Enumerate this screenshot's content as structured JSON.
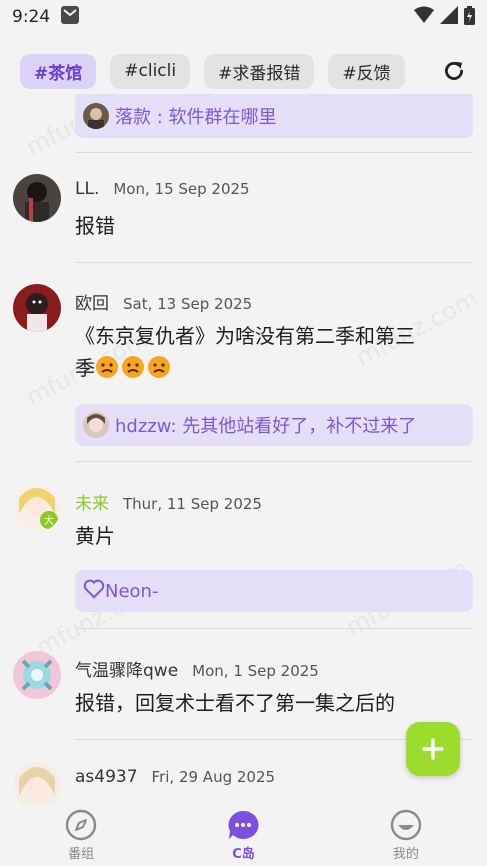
{
  "status_bar": {
    "time": "9:24"
  },
  "tags": [
    {
      "label": "#茶馆",
      "active": true
    },
    {
      "label": "#clicli",
      "active": false
    },
    {
      "label": "#求番报错",
      "active": false
    },
    {
      "label": "#反馈",
      "active": false
    }
  ],
  "watermark": "mfunz.com",
  "partial_quote": {
    "text": "落款 : 软件群在哪里"
  },
  "posts": [
    {
      "author": "LL.",
      "date": "Mon, 15 Sep 2025",
      "content": "报错"
    },
    {
      "author": "欧回",
      "date": "Sat, 13 Sep 2025",
      "content_line1": "《东京复仇者》为啥没有第二季和第三",
      "content_line2": "季",
      "quote": "hdzzw: 先其他站看好了，补不过来了"
    },
    {
      "author": "未来",
      "date": "Thur, 11 Sep 2025",
      "content": "黄片",
      "like": "Neon-"
    },
    {
      "author": "气温骤降qwe",
      "date": "Mon, 1 Sep 2025",
      "content": "报错，回复术士看不了第一集之后的"
    },
    {
      "author": "as4937",
      "date": "Fri, 29 Aug 2025"
    }
  ],
  "nav": [
    {
      "label": "番组",
      "icon": "compass-icon",
      "active": false
    },
    {
      "label": "C岛",
      "icon": "chat-bubble-icon",
      "active": true
    },
    {
      "label": "我的",
      "icon": "smile-face-icon",
      "active": false
    }
  ],
  "colors": {
    "accent": "#7d4fe0",
    "fab": "#9bdc2c",
    "tag_active_bg": "#ddd3f6",
    "quote_bg": "#e5def7",
    "green_name": "#8ac926"
  }
}
